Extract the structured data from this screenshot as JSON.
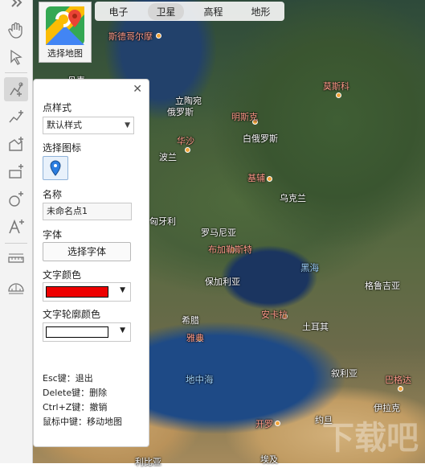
{
  "map_switcher": {
    "label": "选择地图"
  },
  "map_types": [
    {
      "label": "电子",
      "active": false
    },
    {
      "label": "卫星",
      "active": true
    },
    {
      "label": "高程",
      "active": false
    },
    {
      "label": "地形",
      "active": false
    }
  ],
  "toolbar": {
    "tools": [
      "expand-icon",
      "hand-icon",
      "pointer-icon",
      "point-marker-icon",
      "polyline-icon",
      "area-icon",
      "rectangle-icon",
      "circle-icon",
      "text-icon",
      "ruler-icon",
      "protractor-icon"
    ]
  },
  "panel": {
    "close": "✕",
    "point_style_label": "点样式",
    "point_style_value": "默认样式",
    "choose_icon_label": "选择图标",
    "name_label": "名称",
    "name_value": "未命名点1",
    "font_label": "字体",
    "choose_font_button": "选择字体",
    "text_color_label": "文字颜色",
    "text_color": "#ee0000",
    "outline_color_label": "文字轮廓颜色",
    "outline_color": "#ffffff",
    "help": [
      "Esc键：退出",
      "Delete键：删除",
      "Ctrl+Z键：撤销",
      "鼠标中键：移动地图"
    ]
  },
  "map_labels": {
    "norway": "斯德哥尔摩",
    "denmark": "丹麦",
    "tallinn": "立陶宛",
    "russia": "俄罗斯",
    "minsk": "明斯克",
    "moscow": "莫斯科",
    "belarus": "白俄罗斯",
    "warsaw": "华沙",
    "poland": "波兰",
    "kiev": "基辅",
    "ukraine": "乌克兰",
    "hungary": "匈牙利",
    "romania": "罗马尼亚",
    "bucharest": "布加勒斯特",
    "black_sea": "黑海",
    "georgia": "格鲁吉亚",
    "bulgaria": "保加利亚",
    "greece": "希腊",
    "ankara": "安卡拉",
    "turkey": "土耳其",
    "athens": "雅典",
    "mediterranean": "地中海",
    "syria": "叙利亚",
    "baghdad": "巴格达",
    "iraq": "伊拉克",
    "cairo": "开罗",
    "jordan": "约旦",
    "egypt": "埃及",
    "libya": "利比亚"
  },
  "watermark": "下载吧"
}
